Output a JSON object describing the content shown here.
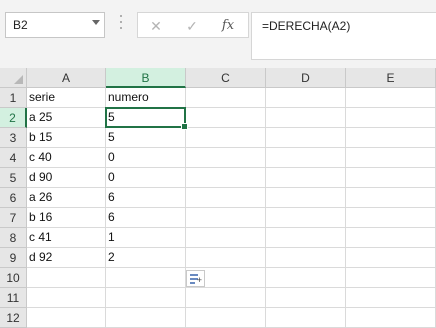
{
  "name_box": {
    "value": "B2"
  },
  "formula_bar": {
    "cancel_glyph": "✕",
    "enter_glyph": "✓",
    "fx_glyph": "fx",
    "formula": "=DERECHA(A2)"
  },
  "sheet": {
    "columns": [
      "A",
      "B",
      "C",
      "D",
      "E"
    ],
    "rows": [
      "1",
      "2",
      "3",
      "4",
      "5",
      "6",
      "7",
      "8",
      "9",
      "10",
      "11",
      "12"
    ],
    "cells": [
      [
        "serie",
        "numero",
        "",
        "",
        ""
      ],
      [
        "a 25",
        "5",
        "",
        "",
        ""
      ],
      [
        "b 15",
        "5",
        "",
        "",
        ""
      ],
      [
        "c 40",
        "0",
        "",
        "",
        ""
      ],
      [
        "d 90",
        "0",
        "",
        "",
        ""
      ],
      [
        "a 26",
        "6",
        "",
        "",
        ""
      ],
      [
        "b 16",
        "6",
        "",
        "",
        ""
      ],
      [
        "c 41",
        "1",
        "",
        "",
        ""
      ],
      [
        "d 92",
        "2",
        "",
        "",
        ""
      ],
      [
        "",
        "",
        "",
        "",
        ""
      ],
      [
        "",
        "",
        "",
        "",
        ""
      ],
      [
        "",
        "",
        "",
        "",
        ""
      ]
    ],
    "selected_column": "B",
    "selected_row": "2"
  },
  "paste_options": {
    "icon": "paste-options-icon",
    "plus": "+"
  },
  "colors": {
    "accent": "#217346",
    "header_bg": "#e6e6e6",
    "selected_header_bg": "#d3f0e0"
  }
}
